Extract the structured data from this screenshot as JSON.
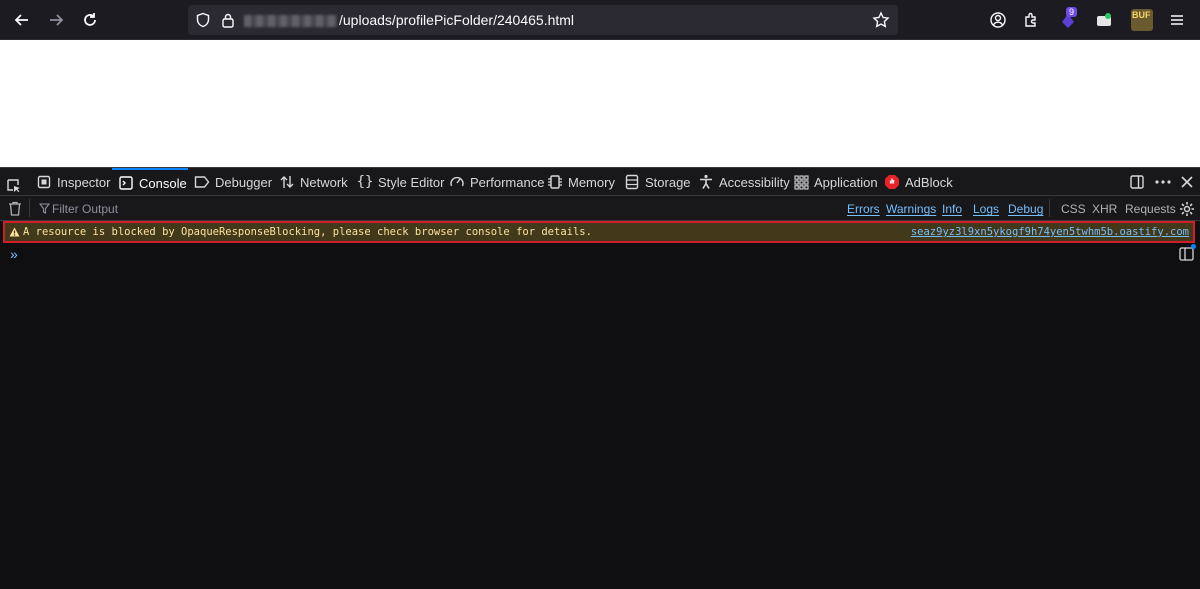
{
  "browser": {
    "url_host_redacted": "",
    "url_path": "/uploads/profilePicFolder/240465.html",
    "extension_badge": "9",
    "buf_label": "BUF"
  },
  "devtools": {
    "tabs": [
      {
        "label": "Inspector",
        "icon": "inspector-icon"
      },
      {
        "label": "Console",
        "icon": "console-icon"
      },
      {
        "label": "Debugger",
        "icon": "debugger-icon"
      },
      {
        "label": "Network",
        "icon": "network-icon"
      },
      {
        "label": "Style Editor",
        "icon": "style-editor-icon"
      },
      {
        "label": "Performance",
        "icon": "performance-icon"
      },
      {
        "label": "Memory",
        "icon": "memory-icon"
      },
      {
        "label": "Storage",
        "icon": "storage-icon"
      },
      {
        "label": "Accessibility",
        "icon": "accessibility-icon"
      },
      {
        "label": "Application",
        "icon": "application-icon"
      },
      {
        "label": "AdBlock",
        "icon": "adblock-icon"
      }
    ],
    "selected_tab": "Console",
    "filter_placeholder": "Filter Output",
    "levels": [
      "Errors",
      "Warnings",
      "Info",
      "Logs",
      "Debug"
    ],
    "requests": [
      "CSS",
      "XHR",
      "Requests"
    ],
    "message": {
      "level": "warning",
      "text": "A resource is blocked by OpaqueResponseBlocking, please check browser console for details.",
      "source": "seaz9yz3l9xn5ykogf9h74yen5twhm5b.oastify.com"
    },
    "prompt": "»"
  },
  "colors": {
    "accent": "#0a84ff",
    "warning_bg": "#42381a",
    "warning_text": "#fce19f",
    "highlight_border": "#d11f2a",
    "link": "#75bfff"
  }
}
